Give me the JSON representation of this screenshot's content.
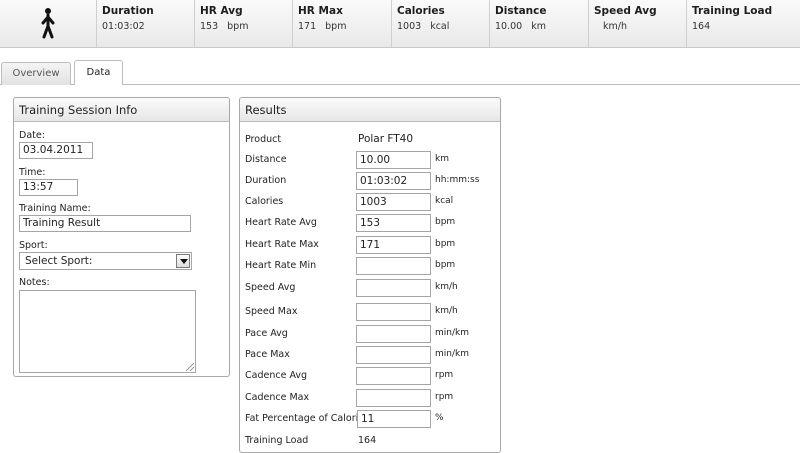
{
  "summary": [
    {
      "label": "Duration",
      "value": "01:03:02",
      "unit": ""
    },
    {
      "label": "HR Avg",
      "value": "153",
      "unit": "bpm"
    },
    {
      "label": "HR Max",
      "value": "171",
      "unit": "bpm"
    },
    {
      "label": "Calories",
      "value": "1003",
      "unit": "kcal"
    },
    {
      "label": "Distance",
      "value": "10.00",
      "unit": "km"
    },
    {
      "label": "Speed Avg",
      "value": "",
      "unit": "km/h"
    },
    {
      "label": "Training Load",
      "value": "164",
      "unit": ""
    }
  ],
  "tabs": [
    {
      "label": "Overview",
      "active": false
    },
    {
      "label": "Data",
      "active": true
    }
  ],
  "session": {
    "title": "Training Session Info",
    "date_label": "Date:",
    "date_value": "03.04.2011",
    "time_label": "Time:",
    "time_value": "13:57",
    "name_label": "Training Name:",
    "name_value": "Training Result",
    "sport_label": "Sport:",
    "sport_value": "Select Sport:",
    "notes_label": "Notes:"
  },
  "results": {
    "title": "Results",
    "product_label": "Product",
    "product_value": "Polar FT40",
    "rows": [
      {
        "label": "Distance",
        "value": "10.00",
        "unit": "km"
      },
      {
        "label": "Duration",
        "value": "01:03:02",
        "unit": "hh:mm:ss"
      },
      {
        "label": "Calories",
        "value": "1003",
        "unit": "kcal"
      },
      {
        "label": "Heart Rate Avg",
        "value": "153",
        "unit": "bpm"
      },
      {
        "label": "Heart Rate Max",
        "value": "171",
        "unit": "bpm"
      },
      {
        "label": "Heart Rate Min",
        "value": "",
        "unit": "bpm"
      },
      {
        "label": "Speed Avg",
        "value": "",
        "unit": "km/h"
      },
      {
        "label": "Speed Max",
        "value": "",
        "unit": "km/h"
      },
      {
        "label": "Pace Avg",
        "value": "",
        "unit": "min/km"
      },
      {
        "label": "Pace Max",
        "value": "",
        "unit": "min/km"
      },
      {
        "label": "Cadence Avg",
        "value": "",
        "unit": "rpm"
      },
      {
        "label": "Cadence Max",
        "value": "",
        "unit": "rpm"
      },
      {
        "label": "Fat Percentage of Calories",
        "value": "11",
        "unit": "%"
      }
    ],
    "load_label": "Training Load",
    "load_value": "164"
  },
  "icons": {
    "summary": "person-walking-icon",
    "sport_dropdown": "chevron-down-icon",
    "notes_resize": "resize-grip-icon"
  }
}
